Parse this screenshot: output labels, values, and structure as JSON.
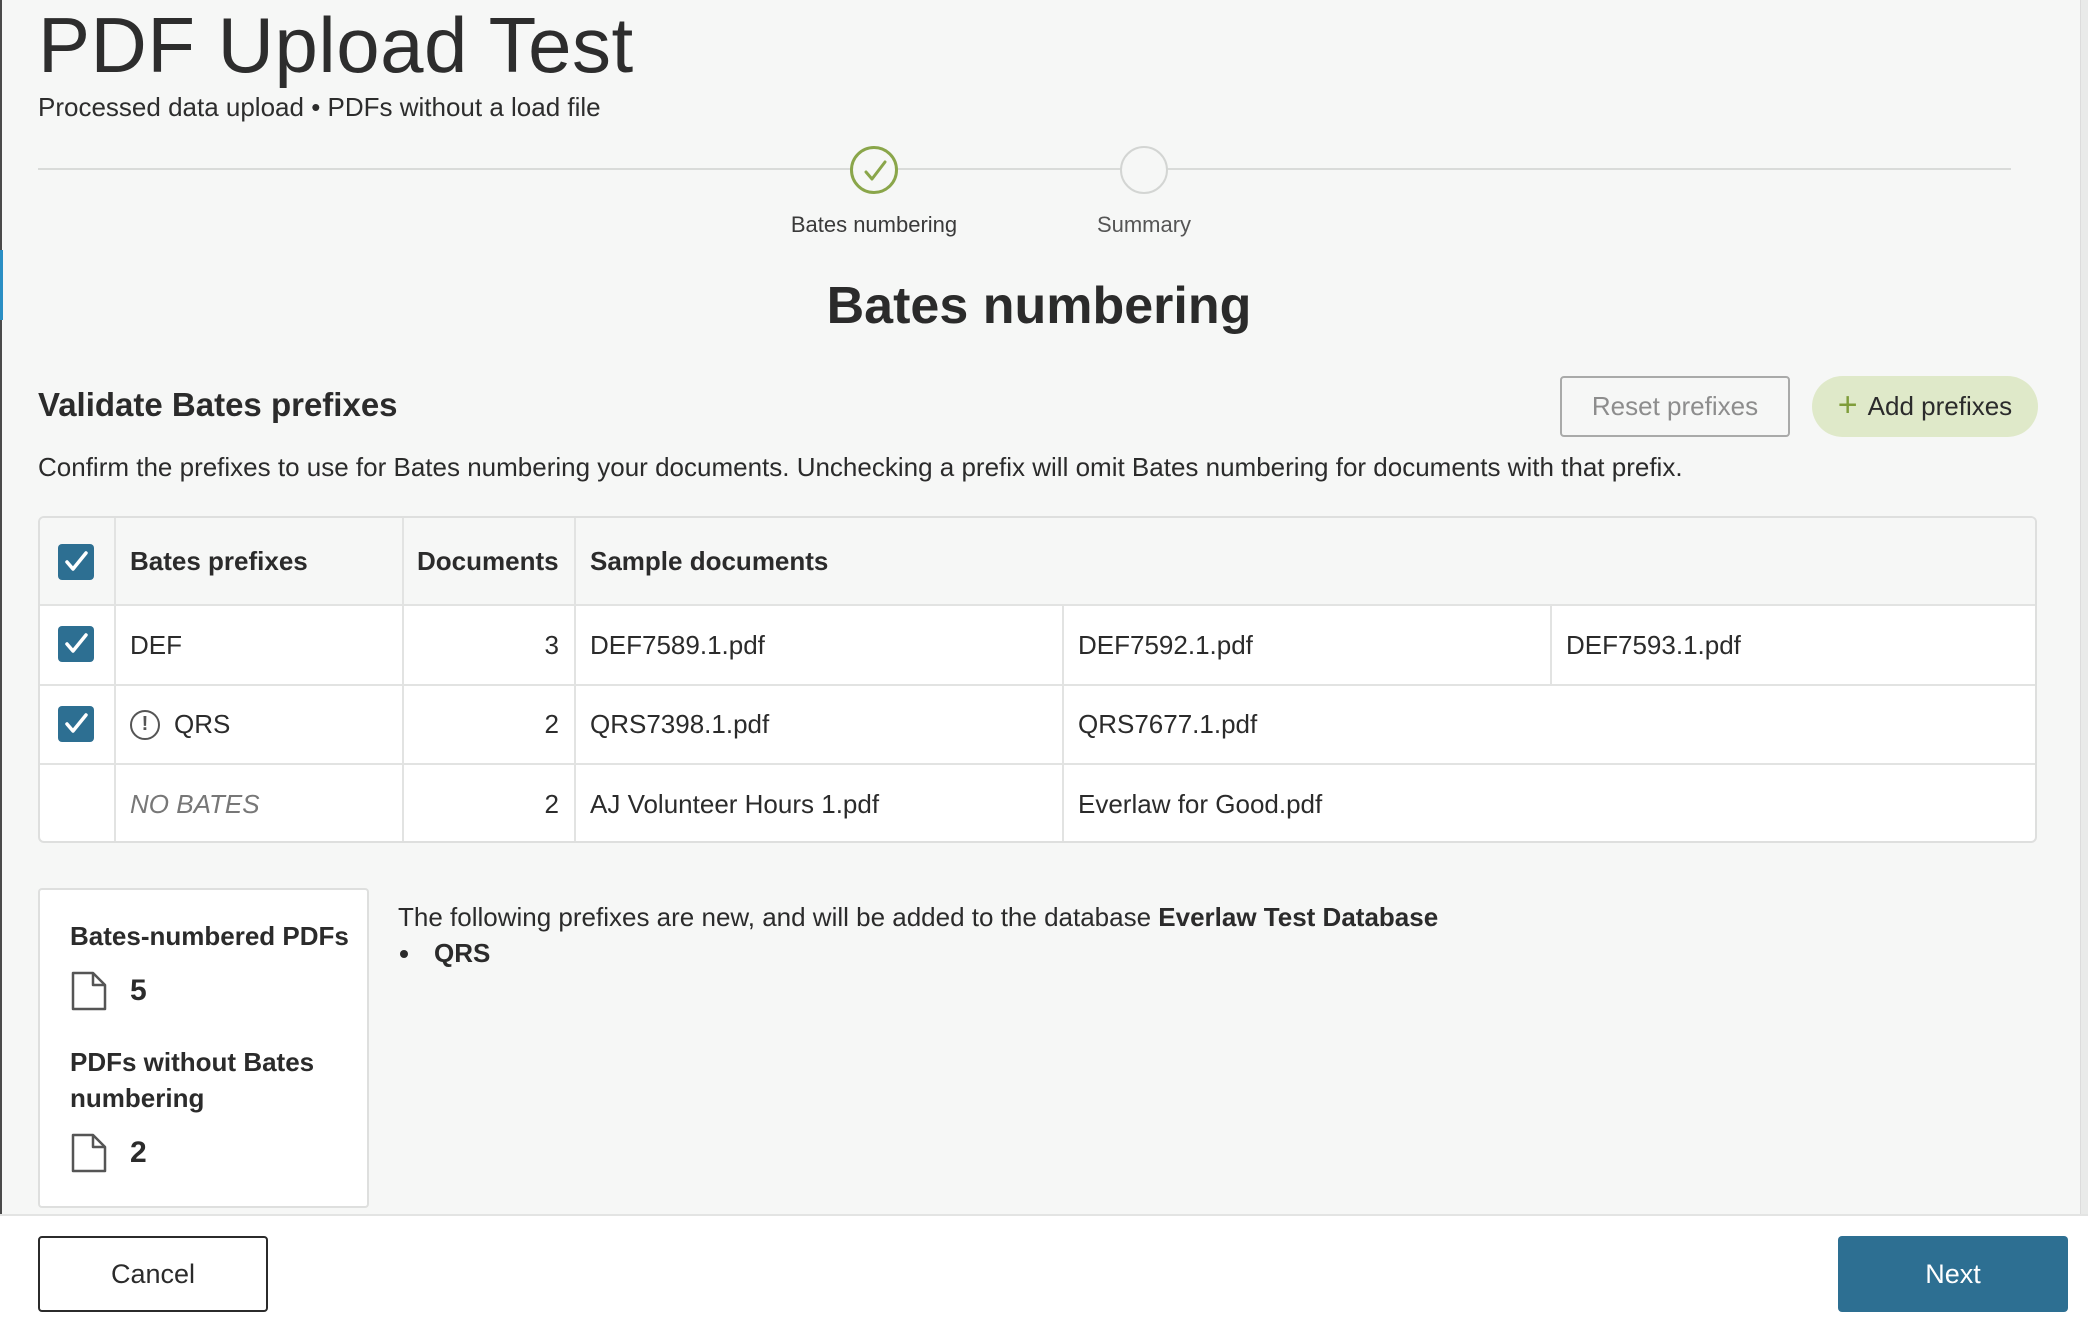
{
  "header": {
    "title": "PDF Upload Test",
    "subtitle": "Processed data upload • PDFs without a load file"
  },
  "stepper": {
    "steps": [
      {
        "label": "Bates numbering",
        "status": "complete"
      },
      {
        "label": "Summary",
        "status": "pending"
      }
    ]
  },
  "main": {
    "section_title": "Bates numbering",
    "validate_heading": "Validate Bates prefixes",
    "reset_label": "Reset prefixes",
    "add_label": "Add prefixes",
    "description": "Confirm the prefixes to use for Bates numbering your documents. Unchecking a prefix will omit Bates numbering for documents with that prefix."
  },
  "table": {
    "columns": [
      "Bates prefixes",
      "Documents",
      "Sample documents"
    ],
    "select_all_checked": true,
    "rows": [
      {
        "checked": true,
        "warning": false,
        "prefix": "DEF",
        "documents": "3",
        "samples": [
          "DEF7589.1.pdf",
          "DEF7592.1.pdf",
          "DEF7593.1.pdf"
        ]
      },
      {
        "checked": true,
        "warning": true,
        "prefix": "QRS",
        "documents": "2",
        "samples": [
          "QRS7398.1.pdf",
          "QRS7677.1.pdf"
        ]
      },
      {
        "checked": null,
        "warning": false,
        "prefix": "NO BATES",
        "documents": "2",
        "samples": [
          "AJ Volunteer Hours 1.pdf",
          "Everlaw for Good.pdf"
        ]
      }
    ]
  },
  "summary": {
    "bates_numbered_label": "Bates-numbered PDFs",
    "bates_numbered_count": "5",
    "without_bates_label": "PDFs without Bates numbering",
    "without_bates_count": "2"
  },
  "new_prefixes": {
    "text": "The following prefixes are new, and will be added to the database ",
    "database": "Everlaw Test Database",
    "items": [
      "QRS"
    ]
  },
  "footer": {
    "cancel_label": "Cancel",
    "next_label": "Next"
  },
  "colors": {
    "primary": "#2d6f92",
    "success": "#8aa64a",
    "add_bg": "#dfe9c9"
  },
  "icons": [
    "check-icon",
    "warning-icon",
    "plus-icon",
    "document-icon"
  ]
}
